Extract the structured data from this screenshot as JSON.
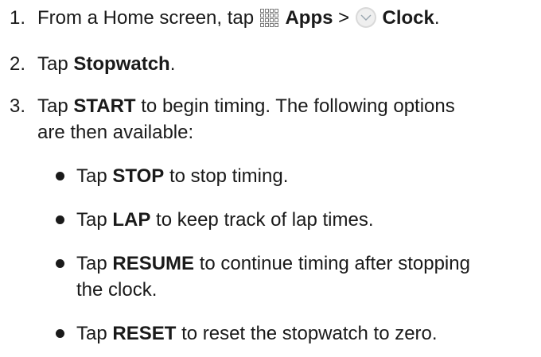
{
  "steps": [
    {
      "num": "1.",
      "pre": "From a Home screen, tap",
      "apps": "Apps",
      "sep": ">",
      "clock": "Clock",
      "end": "."
    },
    {
      "num": "2.",
      "pre": "Tap",
      "bold": "Stopwatch",
      "end": "."
    },
    {
      "num": "3.",
      "pre": "Tap",
      "bold": "START",
      "line1": "to begin timing. The following options",
      "line2": "are then available:"
    }
  ],
  "bullets": [
    {
      "pre": "Tap",
      "bold": "STOP",
      "post": "to stop timing."
    },
    {
      "pre": "Tap",
      "bold": "LAP",
      "post": "to keep track of lap times."
    },
    {
      "pre": "Tap",
      "bold": "RESUME",
      "post": "to continue timing after stopping",
      "line2": "the clock."
    },
    {
      "pre": "Tap",
      "bold": "RESET",
      "post": "to reset the stopwatch to zero."
    }
  ],
  "icons": {
    "apps": "apps-grid-icon",
    "clock": "clock-icon"
  }
}
